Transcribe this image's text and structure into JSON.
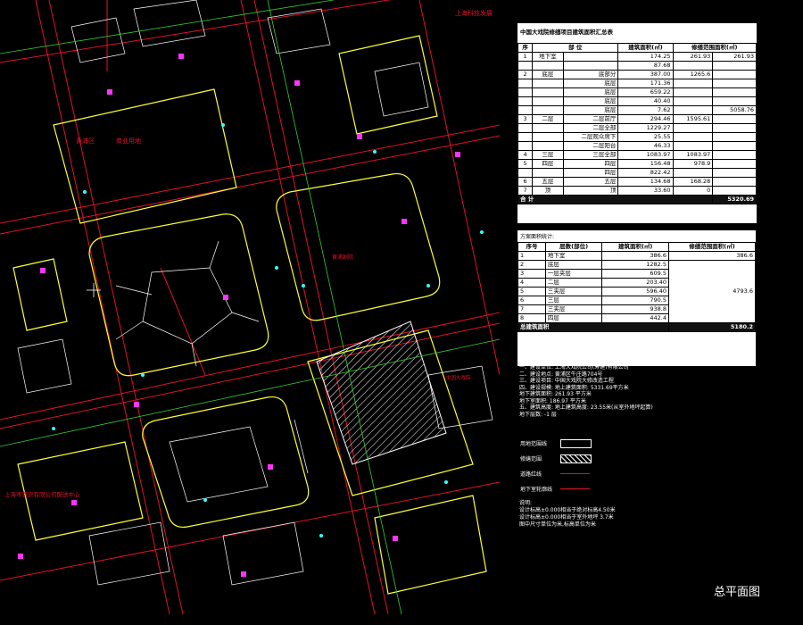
{
  "map": {
    "label_tl": "上海科技发展",
    "label_block1": "黄浦区",
    "label_block2": "商业用地",
    "label_center": "黄浦剧院",
    "label_bottom": "上海市百货有限公司配送中心",
    "label_east": "中国大戏院"
  },
  "table1": {
    "title": "中国大戏院修缮项目建筑面积汇总表",
    "headers": [
      "序",
      "部 位",
      "建筑面积(㎡)",
      "修缮范围面积(㎡)"
    ],
    "rows": [
      {
        "no": "1",
        "part": "地下室",
        "sub": "",
        "area": "174.25",
        "sum1": "261.93",
        "sum2": "261.93"
      },
      {
        "no": "",
        "part": "",
        "sub": "",
        "area": "87.68",
        "sum1": "",
        "sum2": ""
      },
      {
        "no": "2",
        "part": "底层",
        "sub": "底部分",
        "area": "387.00",
        "sum1": "1265.6",
        "sum2": ""
      },
      {
        "no": "",
        "part": "",
        "sub": "底层",
        "area": "171.36",
        "sum1": "",
        "sum2": ""
      },
      {
        "no": "",
        "part": "",
        "sub": "底层",
        "area": "659.22",
        "sum1": "",
        "sum2": ""
      },
      {
        "no": "",
        "part": "",
        "sub": "底层",
        "area": "40.40",
        "sum1": "",
        "sum2": ""
      },
      {
        "no": "",
        "part": "",
        "sub": "底层",
        "area": "7.62",
        "sum1": "",
        "sum2": "5058.76"
      },
      {
        "no": "3",
        "part": "二层",
        "sub": "二层前厅",
        "area": "294.46",
        "sum1": "1595.61",
        "sum2": ""
      },
      {
        "no": "",
        "part": "",
        "sub": "二层全部",
        "area": "1229.27",
        "sum1": "",
        "sum2": ""
      },
      {
        "no": "",
        "part": "",
        "sub": "二层观众席下",
        "area": "25.55",
        "sum1": "",
        "sum2": ""
      },
      {
        "no": "",
        "part": "",
        "sub": "二层阳台",
        "area": "46.33",
        "sum1": "",
        "sum2": ""
      },
      {
        "no": "4",
        "part": "三层",
        "sub": "三层全部",
        "area": "1083.97",
        "sum1": "1083.97",
        "sum2": ""
      },
      {
        "no": "5",
        "part": "四层",
        "sub": "四层",
        "area": "156.48",
        "sum1": "978.9",
        "sum2": ""
      },
      {
        "no": "",
        "part": "",
        "sub": "四层",
        "area": "822.42",
        "sum1": "",
        "sum2": ""
      },
      {
        "no": "6",
        "part": "五层",
        "sub": "五层",
        "area": "134.68",
        "sum1": "168.28",
        "sum2": ""
      },
      {
        "no": "7",
        "part": "顶",
        "sub": "顶",
        "area": "33.60",
        "sum1": "0",
        "sum2": ""
      }
    ],
    "total_label": "合 计",
    "total": "5320.69"
  },
  "table2": {
    "title": "方案面积统计:",
    "headers": [
      "序号",
      "层数(部位)",
      "建筑面积(㎡)",
      "修缮范围面积(㎡)"
    ],
    "rows": [
      {
        "no": "1",
        "part": "地下室",
        "area": "386.6"
      },
      {
        "no": "2",
        "part": "底层",
        "area": "1282.5"
      },
      {
        "no": "3",
        "part": "一层夹层",
        "area": "609.5"
      },
      {
        "no": "4",
        "part": "二层",
        "area": "203.40"
      },
      {
        "no": "5",
        "part": "三夹层",
        "area": "596.40"
      },
      {
        "no": "6",
        "part": "三层",
        "area": "790.5"
      },
      {
        "no": "7",
        "part": "三夹层",
        "area": "938.8"
      },
      {
        "no": "8",
        "part": "四层",
        "area": "442.4"
      }
    ],
    "sum_a": "386.6",
    "sum_b": "4793.6",
    "total_label": "总建筑面积",
    "total": "5180.2"
  },
  "notes": [
    "一、建设单位: 上海大戏院公司(筹建)有限公司",
    "二、建设地点: 黄浦区牛庄路704号",
    "三、建设项目: 中国大戏院大修改造工程",
    "四、建设规模: 地上建筑面积: 5331.69平方米",
    "        地下建筑面积: 261.93 平方米",
    "        地下室面积: 186.97 平方米",
    "五、建筑高度: 地上建筑高度: 23.55米(从室外地坪起算)",
    "        地下层数: -1 层"
  ],
  "legend": [
    {
      "label": "用地范围线",
      "kind": "box"
    },
    {
      "label": "修缮范围",
      "kind": "hatch"
    },
    {
      "label": "道路红线",
      "kind": "red"
    },
    {
      "label": "地下室轮廓线",
      "kind": "red2"
    }
  ],
  "foot": [
    "说明:",
    "设计标高±0.000相当于绝对标高4.50米",
    "设计标高±0.000相当于室外地坪 3.7米",
    "图中尺寸单位为米,标高单位为米"
  ],
  "caption": "总平面图"
}
